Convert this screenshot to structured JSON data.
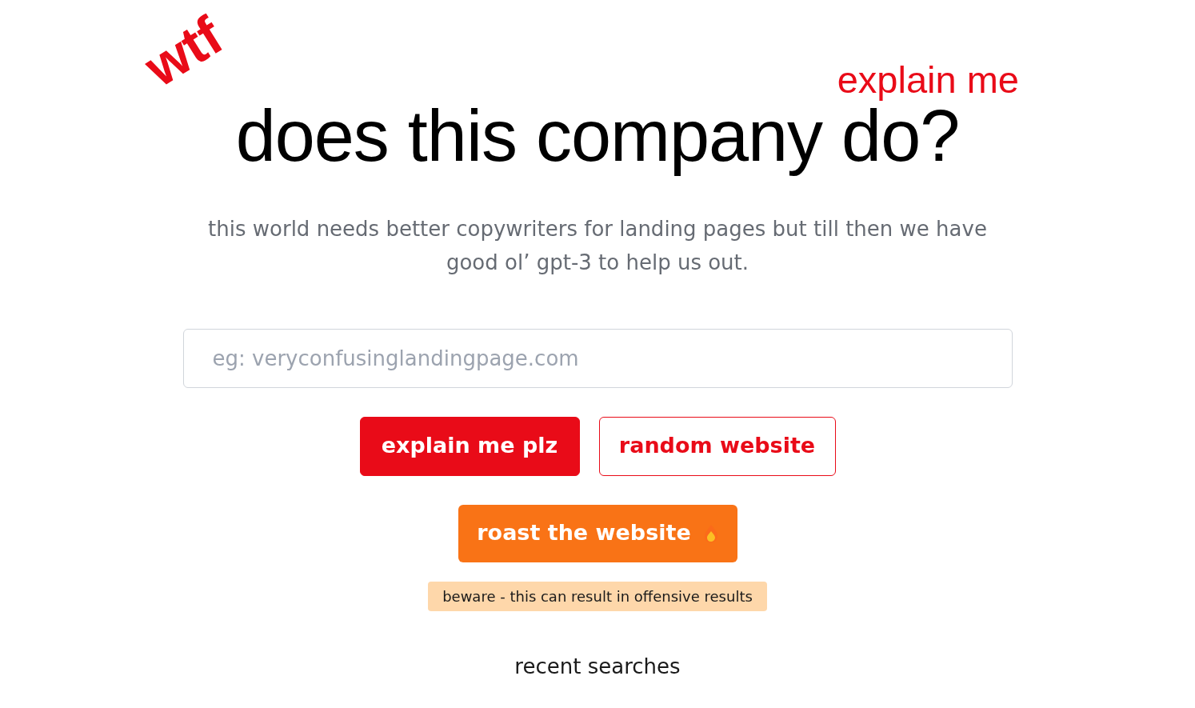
{
  "heading": {
    "badge": "wtf",
    "kicker": "explain me",
    "title": "does this company do?"
  },
  "subtitle": "this world needs better copywriters for landing pages but till then we have good ol’ gpt-3 to help us out.",
  "search": {
    "placeholder": "eg: veryconfusinglandingpage.com"
  },
  "buttons": [
    {
      "label": "explain me plz",
      "kind": "primary"
    },
    {
      "label": "random website",
      "kind": "outline"
    }
  ],
  "roast": {
    "label": "roast the website",
    "warning": "beware - this can result in offensive results"
  },
  "recent_searches": {
    "title": "recent searches"
  }
}
